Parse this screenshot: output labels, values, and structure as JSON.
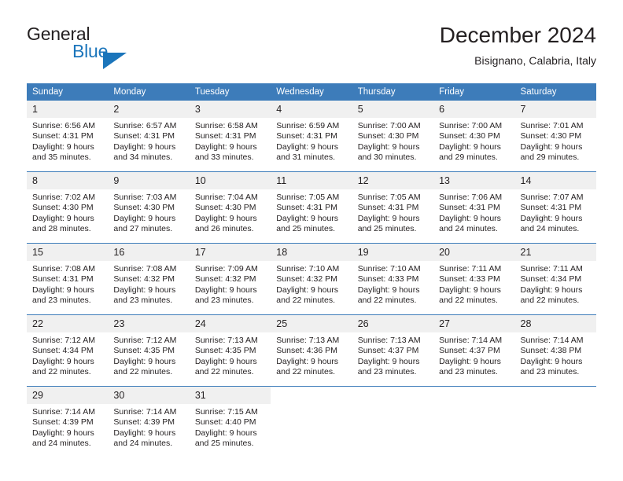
{
  "brand": {
    "name_part1": "General",
    "name_part2": "Blue",
    "logo_icon": "triangle-icon",
    "accent_color": "#1b75bb"
  },
  "header": {
    "title": "December 2024",
    "location": "Bisignano, Calabria, Italy"
  },
  "calendar": {
    "header_bg": "#3d7cba",
    "daynum_bg": "#f0f0f0",
    "weekday_headers": [
      "Sunday",
      "Monday",
      "Tuesday",
      "Wednesday",
      "Thursday",
      "Friday",
      "Saturday"
    ],
    "weeks": [
      [
        {
          "day": "1",
          "sunrise": "Sunrise: 6:56 AM",
          "sunset": "Sunset: 4:31 PM",
          "daylight_line1": "Daylight: 9 hours",
          "daylight_line2": "and 35 minutes."
        },
        {
          "day": "2",
          "sunrise": "Sunrise: 6:57 AM",
          "sunset": "Sunset: 4:31 PM",
          "daylight_line1": "Daylight: 9 hours",
          "daylight_line2": "and 34 minutes."
        },
        {
          "day": "3",
          "sunrise": "Sunrise: 6:58 AM",
          "sunset": "Sunset: 4:31 PM",
          "daylight_line1": "Daylight: 9 hours",
          "daylight_line2": "and 33 minutes."
        },
        {
          "day": "4",
          "sunrise": "Sunrise: 6:59 AM",
          "sunset": "Sunset: 4:31 PM",
          "daylight_line1": "Daylight: 9 hours",
          "daylight_line2": "and 31 minutes."
        },
        {
          "day": "5",
          "sunrise": "Sunrise: 7:00 AM",
          "sunset": "Sunset: 4:30 PM",
          "daylight_line1": "Daylight: 9 hours",
          "daylight_line2": "and 30 minutes."
        },
        {
          "day": "6",
          "sunrise": "Sunrise: 7:00 AM",
          "sunset": "Sunset: 4:30 PM",
          "daylight_line1": "Daylight: 9 hours",
          "daylight_line2": "and 29 minutes."
        },
        {
          "day": "7",
          "sunrise": "Sunrise: 7:01 AM",
          "sunset": "Sunset: 4:30 PM",
          "daylight_line1": "Daylight: 9 hours",
          "daylight_line2": "and 29 minutes."
        }
      ],
      [
        {
          "day": "8",
          "sunrise": "Sunrise: 7:02 AM",
          "sunset": "Sunset: 4:30 PM",
          "daylight_line1": "Daylight: 9 hours",
          "daylight_line2": "and 28 minutes."
        },
        {
          "day": "9",
          "sunrise": "Sunrise: 7:03 AM",
          "sunset": "Sunset: 4:30 PM",
          "daylight_line1": "Daylight: 9 hours",
          "daylight_line2": "and 27 minutes."
        },
        {
          "day": "10",
          "sunrise": "Sunrise: 7:04 AM",
          "sunset": "Sunset: 4:30 PM",
          "daylight_line1": "Daylight: 9 hours",
          "daylight_line2": "and 26 minutes."
        },
        {
          "day": "11",
          "sunrise": "Sunrise: 7:05 AM",
          "sunset": "Sunset: 4:31 PM",
          "daylight_line1": "Daylight: 9 hours",
          "daylight_line2": "and 25 minutes."
        },
        {
          "day": "12",
          "sunrise": "Sunrise: 7:05 AM",
          "sunset": "Sunset: 4:31 PM",
          "daylight_line1": "Daylight: 9 hours",
          "daylight_line2": "and 25 minutes."
        },
        {
          "day": "13",
          "sunrise": "Sunrise: 7:06 AM",
          "sunset": "Sunset: 4:31 PM",
          "daylight_line1": "Daylight: 9 hours",
          "daylight_line2": "and 24 minutes."
        },
        {
          "day": "14",
          "sunrise": "Sunrise: 7:07 AM",
          "sunset": "Sunset: 4:31 PM",
          "daylight_line1": "Daylight: 9 hours",
          "daylight_line2": "and 24 minutes."
        }
      ],
      [
        {
          "day": "15",
          "sunrise": "Sunrise: 7:08 AM",
          "sunset": "Sunset: 4:31 PM",
          "daylight_line1": "Daylight: 9 hours",
          "daylight_line2": "and 23 minutes."
        },
        {
          "day": "16",
          "sunrise": "Sunrise: 7:08 AM",
          "sunset": "Sunset: 4:32 PM",
          "daylight_line1": "Daylight: 9 hours",
          "daylight_line2": "and 23 minutes."
        },
        {
          "day": "17",
          "sunrise": "Sunrise: 7:09 AM",
          "sunset": "Sunset: 4:32 PM",
          "daylight_line1": "Daylight: 9 hours",
          "daylight_line2": "and 23 minutes."
        },
        {
          "day": "18",
          "sunrise": "Sunrise: 7:10 AM",
          "sunset": "Sunset: 4:32 PM",
          "daylight_line1": "Daylight: 9 hours",
          "daylight_line2": "and 22 minutes."
        },
        {
          "day": "19",
          "sunrise": "Sunrise: 7:10 AM",
          "sunset": "Sunset: 4:33 PM",
          "daylight_line1": "Daylight: 9 hours",
          "daylight_line2": "and 22 minutes."
        },
        {
          "day": "20",
          "sunrise": "Sunrise: 7:11 AM",
          "sunset": "Sunset: 4:33 PM",
          "daylight_line1": "Daylight: 9 hours",
          "daylight_line2": "and 22 minutes."
        },
        {
          "day": "21",
          "sunrise": "Sunrise: 7:11 AM",
          "sunset": "Sunset: 4:34 PM",
          "daylight_line1": "Daylight: 9 hours",
          "daylight_line2": "and 22 minutes."
        }
      ],
      [
        {
          "day": "22",
          "sunrise": "Sunrise: 7:12 AM",
          "sunset": "Sunset: 4:34 PM",
          "daylight_line1": "Daylight: 9 hours",
          "daylight_line2": "and 22 minutes."
        },
        {
          "day": "23",
          "sunrise": "Sunrise: 7:12 AM",
          "sunset": "Sunset: 4:35 PM",
          "daylight_line1": "Daylight: 9 hours",
          "daylight_line2": "and 22 minutes."
        },
        {
          "day": "24",
          "sunrise": "Sunrise: 7:13 AM",
          "sunset": "Sunset: 4:35 PM",
          "daylight_line1": "Daylight: 9 hours",
          "daylight_line2": "and 22 minutes."
        },
        {
          "day": "25",
          "sunrise": "Sunrise: 7:13 AM",
          "sunset": "Sunset: 4:36 PM",
          "daylight_line1": "Daylight: 9 hours",
          "daylight_line2": "and 22 minutes."
        },
        {
          "day": "26",
          "sunrise": "Sunrise: 7:13 AM",
          "sunset": "Sunset: 4:37 PM",
          "daylight_line1": "Daylight: 9 hours",
          "daylight_line2": "and 23 minutes."
        },
        {
          "day": "27",
          "sunrise": "Sunrise: 7:14 AM",
          "sunset": "Sunset: 4:37 PM",
          "daylight_line1": "Daylight: 9 hours",
          "daylight_line2": "and 23 minutes."
        },
        {
          "day": "28",
          "sunrise": "Sunrise: 7:14 AM",
          "sunset": "Sunset: 4:38 PM",
          "daylight_line1": "Daylight: 9 hours",
          "daylight_line2": "and 23 minutes."
        }
      ],
      [
        {
          "day": "29",
          "sunrise": "Sunrise: 7:14 AM",
          "sunset": "Sunset: 4:39 PM",
          "daylight_line1": "Daylight: 9 hours",
          "daylight_line2": "and 24 minutes."
        },
        {
          "day": "30",
          "sunrise": "Sunrise: 7:14 AM",
          "sunset": "Sunset: 4:39 PM",
          "daylight_line1": "Daylight: 9 hours",
          "daylight_line2": "and 24 minutes."
        },
        {
          "day": "31",
          "sunrise": "Sunrise: 7:15 AM",
          "sunset": "Sunset: 4:40 PM",
          "daylight_line1": "Daylight: 9 hours",
          "daylight_line2": "and 25 minutes."
        },
        {
          "day": "",
          "sunrise": "",
          "sunset": "",
          "daylight_line1": "",
          "daylight_line2": ""
        },
        {
          "day": "",
          "sunrise": "",
          "sunset": "",
          "daylight_line1": "",
          "daylight_line2": ""
        },
        {
          "day": "",
          "sunrise": "",
          "sunset": "",
          "daylight_line1": "",
          "daylight_line2": ""
        },
        {
          "day": "",
          "sunrise": "",
          "sunset": "",
          "daylight_line1": "",
          "daylight_line2": ""
        }
      ]
    ]
  }
}
